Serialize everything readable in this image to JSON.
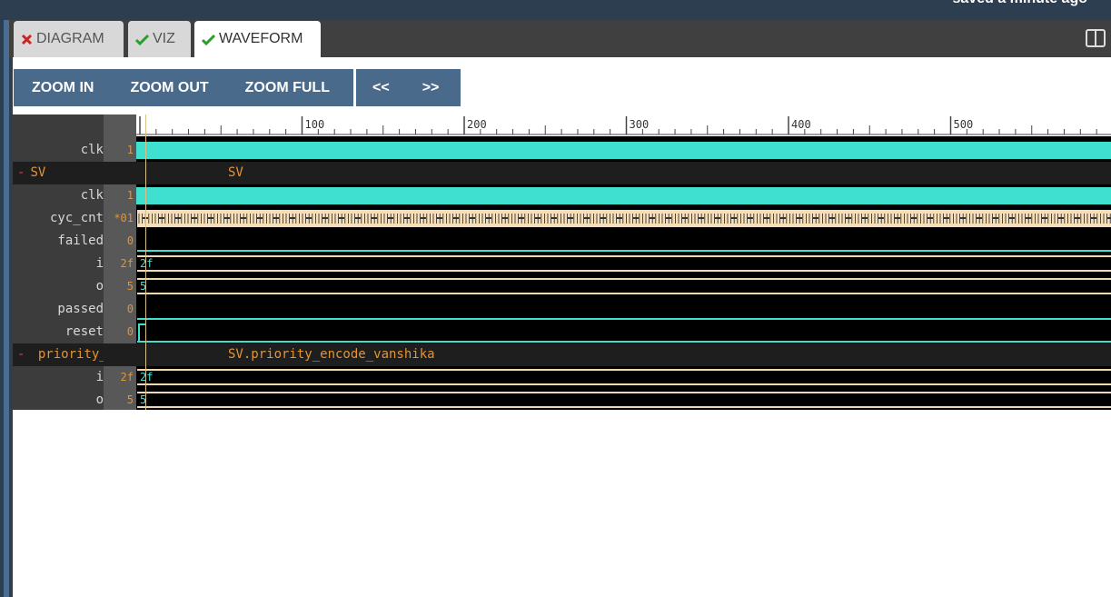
{
  "header": {
    "status": "saved a minute ago"
  },
  "tabs": [
    {
      "label": "DIAGRAM",
      "status": "error",
      "icon": "x-icon",
      "color": "#cc2222"
    },
    {
      "label": "VIZ",
      "status": "ok",
      "icon": "check-icon",
      "color": "#2aa02a"
    },
    {
      "label": "WAVEFORM",
      "status": "ok",
      "icon": "check-icon",
      "color": "#2aa02a",
      "active": true
    }
  ],
  "toolbar": {
    "zoom_in": "ZOOM IN",
    "zoom_out": "ZOOM OUT",
    "zoom_full": "ZOOM FULL",
    "prev": "<<",
    "next": ">>"
  },
  "ruler": {
    "ticks": [
      "100",
      "200",
      "300",
      "400",
      "500"
    ]
  },
  "signals": [
    {
      "name": "clk",
      "value": "1",
      "kind": "clock"
    },
    {
      "name": "SV",
      "toggle": "-",
      "path": "SV",
      "kind": "group"
    },
    {
      "name": "clk",
      "value": "1",
      "kind": "clock"
    },
    {
      "name": "cyc_cnt",
      "value": "*01",
      "kind": "counter"
    },
    {
      "name": "failed",
      "value": "0",
      "kind": "low"
    },
    {
      "name": "i",
      "value": "2f",
      "bus": "2f",
      "kind": "bus"
    },
    {
      "name": "o",
      "value": "5",
      "bus": "5",
      "kind": "bus"
    },
    {
      "name": "passed",
      "value": "0",
      "kind": "low"
    },
    {
      "name": "reset",
      "value": "0",
      "kind": "low"
    },
    {
      "name": "priority_en",
      "toggle": "-",
      "path": "SV.priority_encode_vanshika",
      "kind": "group"
    },
    {
      "name": "i",
      "value": "2f",
      "bus": "2f",
      "kind": "bus"
    },
    {
      "name": "o",
      "value": "5",
      "bus": "5",
      "kind": "bus"
    }
  ],
  "colors": {
    "accent": "#4a6a8c",
    "signal": "#40e0d0",
    "value": "#e39435"
  }
}
